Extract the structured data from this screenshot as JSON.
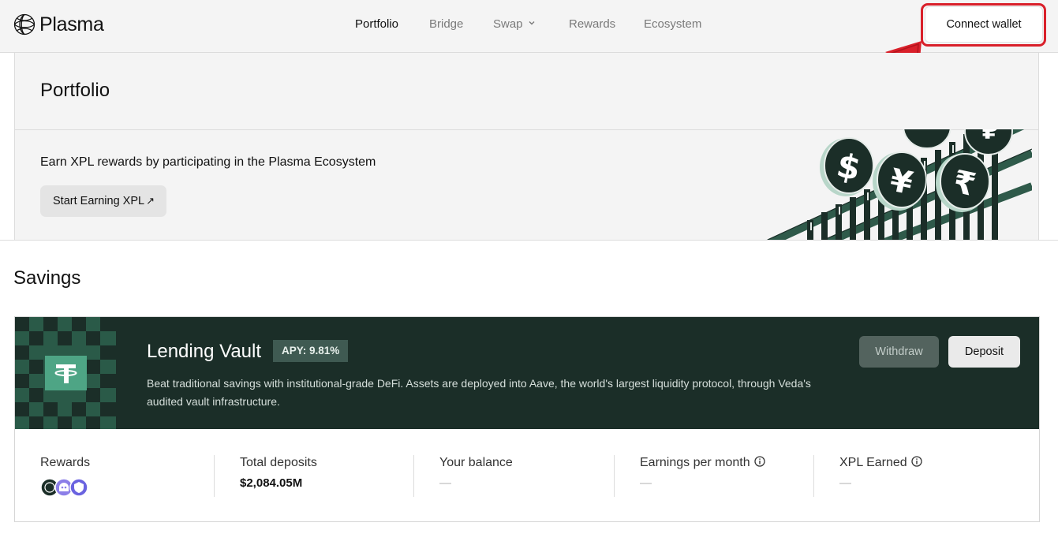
{
  "header": {
    "logo_text": "Plasma",
    "nav": [
      {
        "label": "Portfolio",
        "active": true
      },
      {
        "label": "Bridge",
        "active": false
      },
      {
        "label": "Swap",
        "active": false,
        "has_dropdown": true
      },
      {
        "label": "Rewards",
        "active": false
      },
      {
        "label": "Ecosystem",
        "active": false
      }
    ],
    "connect_label": "Connect wallet"
  },
  "portfolio": {
    "title": "Portfolio",
    "earn_text": "Earn XPL rewards by participating in the Plasma Ecosystem",
    "earn_button": "Start Earning XPL",
    "earn_button_icon": "↗"
  },
  "savings": {
    "title": "Savings",
    "vault": {
      "name": "Lending Vault",
      "apy": "APY: 9.81%",
      "description": "Beat traditional savings with institutional-grade DeFi. Assets are deployed into Aave, the world's largest liquidity protocol, through Veda's audited vault infrastructure.",
      "withdraw_label": "Withdraw",
      "deposit_label": "Deposit",
      "stats": {
        "rewards_label": "Rewards",
        "total_deposits_label": "Total deposits",
        "total_deposits_value": "$2,084.05M",
        "balance_label": "Your balance",
        "balance_value": "—",
        "earnings_label": "Earnings per month",
        "earnings_value": "—",
        "xpl_label": "XPL Earned",
        "xpl_value": "—"
      }
    }
  },
  "colors": {
    "accent_dark_green": "#1b2e28",
    "annotation_red": "#d9202a"
  }
}
